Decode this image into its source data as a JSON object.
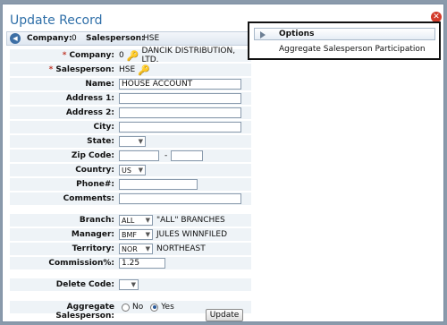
{
  "dialog": {
    "title": "Update Record",
    "close_symbol": "✕"
  },
  "infobar": {
    "company_label": "Company:",
    "company_value": "0",
    "salesperson_label": "Salesperson:",
    "salesperson_value": "HSE"
  },
  "options_panel": {
    "header": "Options",
    "items": [
      "Aggregate Salesperson Participation"
    ]
  },
  "form": {
    "company": {
      "label": "Company:",
      "value": "0",
      "description": "DANCIK DISTRIBUTION, LTD."
    },
    "salesperson": {
      "label": "Salesperson:",
      "value": "HSE"
    },
    "name": {
      "label": "Name:",
      "value": "HOUSE ACCOUNT"
    },
    "address1": {
      "label": "Address 1:",
      "value": ""
    },
    "address2": {
      "label": "Address 2:",
      "value": ""
    },
    "city": {
      "label": "City:",
      "value": ""
    },
    "state": {
      "label": "State:",
      "value": ""
    },
    "zip": {
      "label": "Zip Code:",
      "value": "",
      "ext": "",
      "separator": "-"
    },
    "country": {
      "label": "Country:",
      "value": "US"
    },
    "phone": {
      "label": "Phone#:",
      "value": ""
    },
    "comments": {
      "label": "Comments:",
      "value": ""
    },
    "branch": {
      "label": "Branch:",
      "value": "ALL",
      "description": "\"ALL\" BRANCHES"
    },
    "manager": {
      "label": "Manager:",
      "value": "BMF",
      "description": "JULES WINNFILED"
    },
    "territory": {
      "label": "Territory:",
      "value": "NOR",
      "description": "NORTHEAST"
    },
    "commission": {
      "label": "Commission%:",
      "value": "1.25"
    },
    "delete_code": {
      "label": "Delete Code:",
      "value": ""
    },
    "aggregate": {
      "label": "Aggregate Salesperson:",
      "option_no": "No",
      "option_yes": "Yes",
      "selected": "Yes"
    }
  },
  "buttons": {
    "update": "Update"
  },
  "colors": {
    "title": "#2f6fa8",
    "required": "#c0392b",
    "row_bg": "#eef3f7"
  }
}
